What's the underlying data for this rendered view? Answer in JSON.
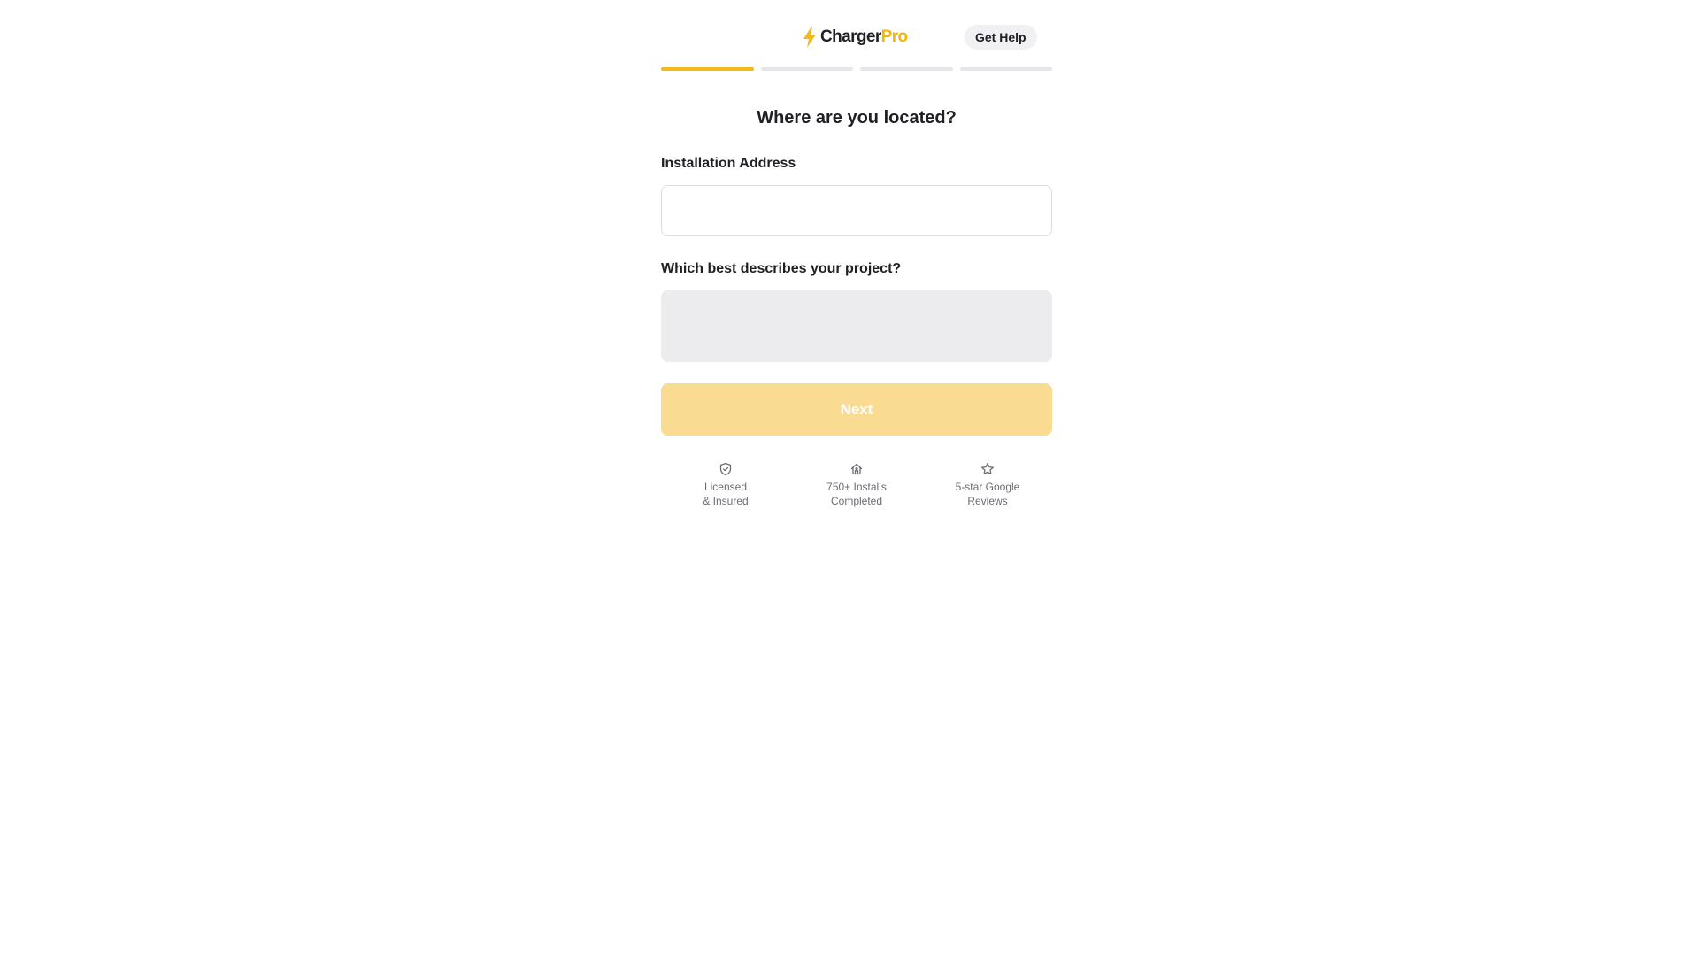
{
  "header": {
    "logo_word1": "Charger",
    "logo_word2": "Pro",
    "help_label": "Get Help"
  },
  "progress": {
    "current_step": 1,
    "total_steps": 4
  },
  "form": {
    "title": "Where are you located?",
    "address_label": "Installation Address",
    "address_value": "",
    "project_label": "Which best describes your project?",
    "project_value": "",
    "next_label": "Next"
  },
  "trust_badges": [
    {
      "icon": "shield-check-icon",
      "line1": "Licensed",
      "line2": "& Insured"
    },
    {
      "icon": "house-icon",
      "line1": "750+ Installs",
      "line2": "Completed"
    },
    {
      "icon": "star-icon",
      "line1": "5-star Google",
      "line2": "Reviews"
    }
  ],
  "colors": {
    "brand_yellow": "#f5b81c",
    "logo_pro": "#f2b705",
    "next_disabled": "#f9dc92",
    "progress_inactive": "#e6e6ea",
    "select_bg": "#ececef"
  }
}
